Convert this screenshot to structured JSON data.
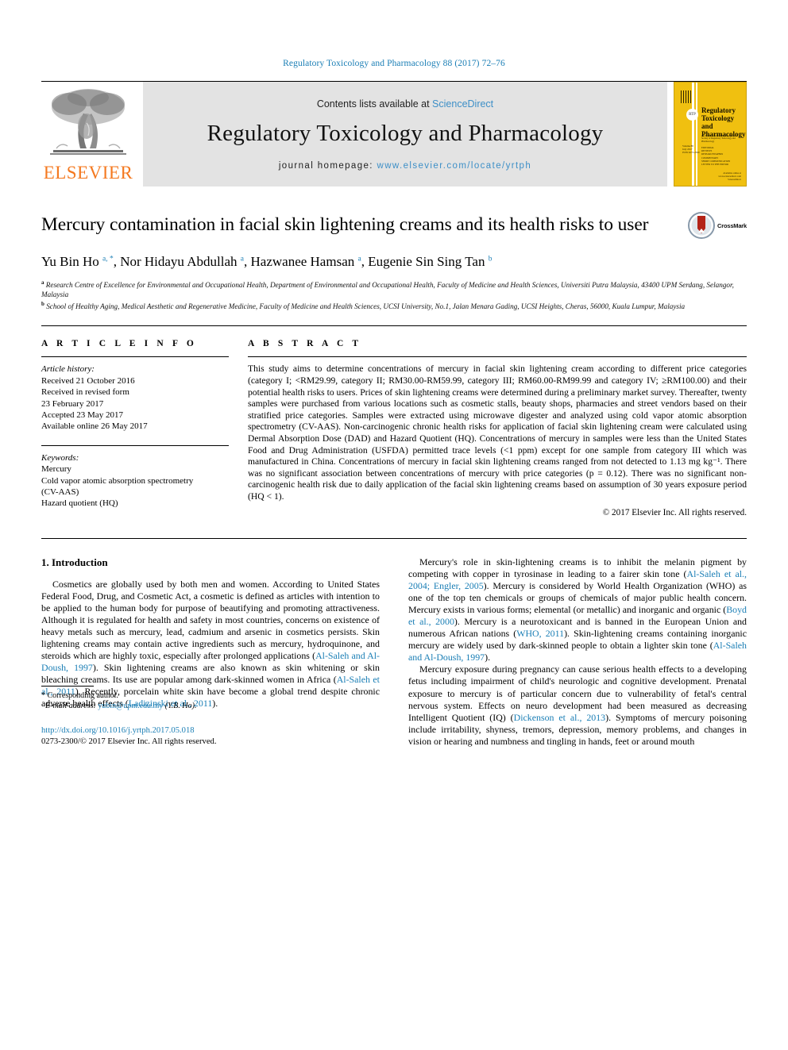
{
  "running_head": "Regulatory Toxicology and Pharmacology 88 (2017) 72–76",
  "header": {
    "publisher": "ELSEVIER",
    "contents_prefix": "Contents lists available at ",
    "contents_link": "ScienceDirect",
    "journal_title": "Regulatory Toxicology and Pharmacology",
    "homepage_prefix": "journal homepage: ",
    "homepage_url": "www.elsevier.com/locate/yrtph",
    "cover": {
      "title": "Regulatory Toxicology and Pharmacology",
      "badge": "RTP",
      "subtitle": "An Official Journal of the International Society of Regulatory Toxicology and Pharmacology",
      "volume_line": "Volume 88\nJuly 2017\nISSN 0273-2300",
      "contents_list": "EDITORIAL\nREVIEWS\nRESEARCH PAPERS\nCOMMENTARY\nSHORT COMMUNICATION\nLETTER TO THE EDITOR",
      "footer": "Available online at\nwww.sciencedirect.com\nScienceDirect"
    }
  },
  "article": {
    "title": "Mercury contamination in facial skin lightening creams and its health risks to user",
    "crossmark_label": "CrossMark",
    "authors_html": "Yu Bin Ho <sup>a, *</sup>, Nor Hidayu Abdullah <sup>a</sup>, Hazwanee Hamsan <sup>a</sup>, Eugenie Sin Sing Tan <sup>b</sup>",
    "affiliations": [
      {
        "marker": "a",
        "text": "Research Centre of Excellence for Environmental and Occupational Health, Department of Environmental and Occupational Health, Faculty of Medicine and Health Sciences, Universiti Putra Malaysia, 43400 UPM Serdang, Selangor, Malaysia"
      },
      {
        "marker": "b",
        "text": "School of Healthy Aging, Medical Aesthetic and Regenerative Medicine, Faculty of Medicine and Health Sciences, UCSI University, No.1, Jalan Menara Gading, UCSI Heights, Cheras, 56000, Kuala Lumpur, Malaysia"
      }
    ]
  },
  "article_info": {
    "heading": "ARTICLE INFO",
    "history_label": "Article history:",
    "history": [
      "Received 21 October 2016",
      "Received in revised form",
      "23 February 2017",
      "Accepted 23 May 2017",
      "Available online 26 May 2017"
    ],
    "keywords_label": "Keywords:",
    "keywords": [
      "Mercury",
      "Cold vapor atomic absorption spectrometry",
      "(CV-AAS)",
      "Hazard quotient (HQ)"
    ]
  },
  "abstract": {
    "heading": "ABSTRACT",
    "text": "This study aims to determine concentrations of mercury in facial skin lightening cream according to different price categories (category I; <RM29.99, category II; RM30.00-RM59.99, category III; RM60.00-RM99.99 and category IV; ≥RM100.00) and their potential health risks to users. Prices of skin lightening creams were determined during a preliminary market survey. Thereafter, twenty samples were purchased from various locations such as cosmetic stalls, beauty shops, pharmacies and street vendors based on their stratified price categories. Samples were extracted using microwave digester and analyzed using cold vapor atomic absorption spectrometry (CV-AAS). Non-carcinogenic chronic health risks for application of facial skin lightening cream were calculated using Dermal Absorption Dose (DAD) and Hazard Quotient (HQ). Concentrations of mercury in samples were less than the United States Food and Drug Administration (USFDA) permitted trace levels (<1 ppm) except for one sample from category III which was manufactured in China. Concentrations of mercury in facial skin lightening creams ranged from not detected to 1.13 mg kg⁻¹. There was no significant association between concentrations of mercury with price categories (p = 0.12). There was no significant non-carcinogenic health risk due to daily application of the facial skin lightening creams based on assumption of 30 years exposure period (HQ < 1).",
    "copyright": "© 2017 Elsevier Inc. All rights reserved."
  },
  "body": {
    "section_title": "1. Introduction",
    "left_paragraphs": [
      {
        "segments": [
          {
            "t": "Cosmetics are globally used by both men and women. According to United States Federal Food, Drug, and Cosmetic Act, a cosmetic is defined as articles with intention to be applied to the human body for purpose of beautifying and promoting attractiveness. Although it is regulated for health and safety in most countries, concerns on existence of heavy metals such as mercury, lead, cadmium and arsenic in cosmetics persists. Skin lightening creams may contain active ingredients such as mercury, hydroquinone, and steroids which are highly toxic, especially after prolonged applications (",
            "link": false
          },
          {
            "t": "Al-Saleh and Al-Doush, 1997",
            "link": true
          },
          {
            "t": "). Skin lightening creams are also known as skin whitening or skin bleaching creams. Its use are popular among dark-skinned women in Africa (",
            "link": false
          },
          {
            "t": "Al-Saleh et al., 2011",
            "link": true
          },
          {
            "t": "). Recently, porcelain white skin have become a global trend despite chronic adverse health effects (",
            "link": false
          },
          {
            "t": "Ladizinski et al., 2011",
            "link": true
          },
          {
            "t": ").",
            "link": false
          }
        ]
      }
    ],
    "right_paragraphs": [
      {
        "segments": [
          {
            "t": "Mercury's role in skin-lightening creams is to inhibit the melanin pigment by competing with copper in tyrosinase in leading to a fairer skin tone (",
            "link": false
          },
          {
            "t": "Al-Saleh et al., 2004; Engler, 2005",
            "link": true
          },
          {
            "t": "). Mercury is considered by World Health Organization (WHO) as one of the top ten chemicals or groups of chemicals of major public health concern. Mercury exists in various forms; elemental (or metallic) and inorganic and organic (",
            "link": false
          },
          {
            "t": "Boyd et al., 2000",
            "link": true
          },
          {
            "t": "). Mercury is a neurotoxicant and is banned in the European Union and numerous African nations (",
            "link": false
          },
          {
            "t": "WHO, 2011",
            "link": true
          },
          {
            "t": "). Skin-lightening creams containing inorganic mercury are widely used by dark-skinned people to obtain a lighter skin tone (",
            "link": false
          },
          {
            "t": "Al-Saleh and Al-Doush, 1997",
            "link": true
          },
          {
            "t": ").",
            "link": false
          }
        ]
      },
      {
        "segments": [
          {
            "t": "Mercury exposure during pregnancy can cause serious health effects to a developing fetus including impairment of child's neurologic and cognitive development. Prenatal exposure to mercury is of particular concern due to vulnerability of fetal's central nervous system. Effects on neuro development had been measured as decreasing Intelligent Quotient (IQ) (",
            "link": false
          },
          {
            "t": "Dickenson et al., 2013",
            "link": true
          },
          {
            "t": "). Symptoms of mercury poisoning include irritability, shyness, tremors, depression, memory problems, and changes in vision or hearing and numbness and tingling in hands, feet or around mouth",
            "link": false
          }
        ]
      }
    ]
  },
  "footnotes": {
    "corresponding": "* Corresponding author.",
    "email_label": "E-mail address:",
    "email": "yubin@upm.edu.my",
    "email_suffix": "(Y.B. Ho).",
    "doi": "http://dx.doi.org/10.1016/j.yrtph.2017.05.018",
    "issn_line": "0273-2300/© 2017 Elsevier Inc. All rights reserved."
  },
  "colors": {
    "link_blue": "#1a7eb5",
    "elsevier_orange": "#F47920",
    "band_gray": "#e3e3e3",
    "cover_yellow": "#f0c010"
  }
}
